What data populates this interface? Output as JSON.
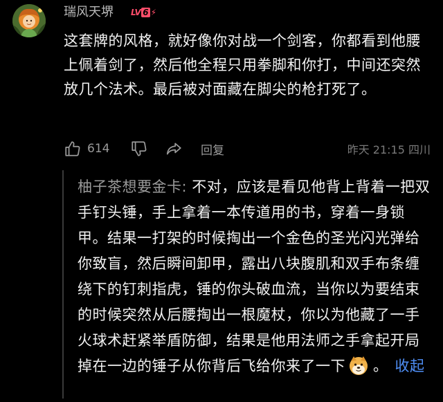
{
  "comment": {
    "username": "瑞风天堺",
    "level": {
      "prefix": "LV",
      "number": "6",
      "bolt": "⚡",
      "color": "#ff4d6a"
    },
    "text": "这套牌的风格，就好像你对战一个剑客，你都看到他腰上佩着剑了，然后他全程只用拳脚和你打，中间还突然放几个法术。最后被对面藏在脚尖的枪打死了。",
    "likes": "614",
    "reply_label": "回复",
    "meta": "昨天 21:15 四川",
    "icons": [
      "thumbs-up-icon",
      "thumbs-down-icon",
      "share-icon"
    ]
  },
  "reply": {
    "author": "柚子茶想要金卡",
    "separator": ": ",
    "text": "不对，应该是看见他背上背着一把双手钉头锤，手上拿着一本传道用的书，穿着一身锁甲。结果一打架的时候掏出一个金色的圣光闪光弹给你致盲，然后瞬间卸甲，露出八块腹肌和双手布条缠绕下的钉刺指虎，锤的你头破血流，当你以为要结束的时候突然从后腰掏出一根魔杖，你以为他藏了一手火球术赶紧举盾防御，结果是他用法师之手拿起开局掉在一边的锤子从你背后飞给你来了一下",
    "emoji": "doge-emoji",
    "after_emoji": "。",
    "collapse_label": "收起"
  },
  "colors": {
    "background": "#000000",
    "text": "#f2f2f2",
    "secondary": "#9a9a9a",
    "link": "#4f8ff7"
  }
}
